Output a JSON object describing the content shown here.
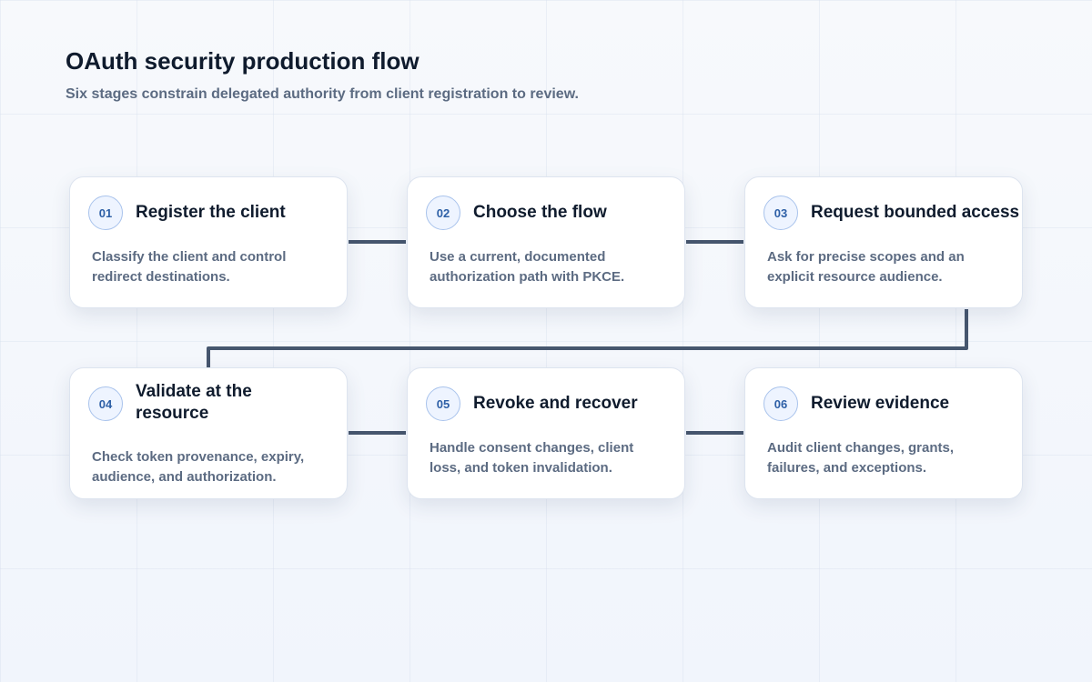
{
  "header": {
    "title": "OAuth security production flow",
    "subtitle": "Six stages constrain delegated authority from client registration to review."
  },
  "colors": {
    "connector": "#46566e",
    "badge_text": "#2d5fa6",
    "badge_border": "#a9c3ec",
    "card_border": "#dde4ef"
  },
  "steps": [
    {
      "number": "01",
      "title": "Register the client",
      "description": "Classify the client and control redirect destinations."
    },
    {
      "number": "02",
      "title": "Choose the flow",
      "description": "Use a current, documented authorization path with PKCE."
    },
    {
      "number": "03",
      "title": "Request bounded access",
      "description": "Ask for precise scopes and an explicit resource audience."
    },
    {
      "number": "04",
      "title": "Validate at the resource",
      "description": "Check token provenance, expiry, audience, and authorization."
    },
    {
      "number": "05",
      "title": "Revoke and recover",
      "description": "Handle consent changes, client loss, and token invalidation."
    },
    {
      "number": "06",
      "title": "Review evidence",
      "description": "Audit client changes, grants, failures, and exceptions."
    }
  ]
}
